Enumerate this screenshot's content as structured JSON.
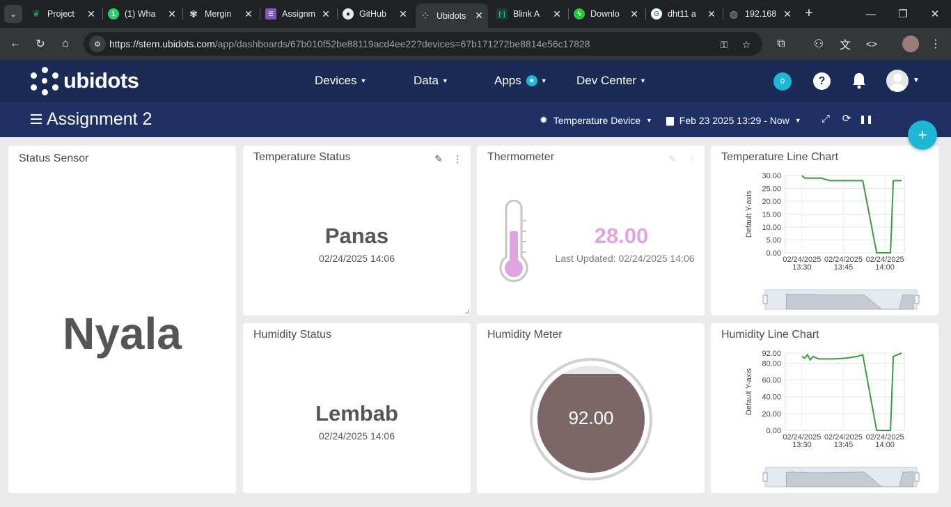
{
  "browser": {
    "tabs": [
      {
        "title": "Project",
        "icon": "mongodb-leaf-icon",
        "color": "#13aa52"
      },
      {
        "title": "(1) Wha",
        "icon": "whatsapp-icon",
        "color": "#25d366"
      },
      {
        "title": "Mergin",
        "icon": "chatgpt-icon",
        "color": "#e8eaed"
      },
      {
        "title": "Assignm",
        "icon": "forms-icon",
        "color": "#7e57c2"
      },
      {
        "title": "GitHub",
        "icon": "github-icon",
        "color": "#e8eaed"
      },
      {
        "title": "Ubidots",
        "icon": "ubidots-icon",
        "color": "#4db6e8"
      },
      {
        "title": "Blink A",
        "icon": "blynk-icon",
        "color": "#23c48e"
      },
      {
        "title": "Downlo",
        "icon": "bolt-icon",
        "color": "#24c73e"
      },
      {
        "title": "dht11 a",
        "icon": "google-icon",
        "color": "#4285f4"
      },
      {
        "title": "192.168",
        "icon": "globe-icon",
        "color": "#9aa0a6"
      }
    ],
    "url_host": "https://stem.ubidots.com",
    "url_path": "/app/dashboards/67b010f52be88119acd4ee22?devices=67b171272be8814e56c17828"
  },
  "header": {
    "logo": "ubidots",
    "nav": [
      "Devices",
      "Data",
      "Apps",
      "Dev Center"
    ],
    "notifications_count": "0",
    "help_label": "?"
  },
  "dashboard": {
    "title": "Assignment 2",
    "device": "Temperature Device",
    "date_range": "Feb 23 2025 13:29 - Now"
  },
  "widgets": {
    "status_sensor": {
      "title": "Status Sensor",
      "value": "Nyala"
    },
    "temperature_status": {
      "title": "Temperature Status",
      "value": "Panas",
      "timestamp": "02/24/2025 14:06"
    },
    "thermometer": {
      "title": "Thermometer",
      "value": "28.00",
      "updated": "Last Updated: 02/24/2025 14:06",
      "level": 0.28,
      "color": "#dfa5e0"
    },
    "humidity_status": {
      "title": "Humidity Status",
      "value": "Lembab",
      "timestamp": "02/24/2025 14:06"
    },
    "humidity_meter": {
      "title": "Humidity Meter",
      "value": "92.00",
      "level": 0.92,
      "color": "#7d6667"
    },
    "temperature_chart": {
      "title": "Temperature Line Chart"
    },
    "humidity_chart": {
      "title": "Humidity Line Chart"
    }
  },
  "chart_data": [
    {
      "type": "line",
      "title": "Temperature Line Chart",
      "ylabel": "Default Y-axis",
      "xlabel": "",
      "ylim": [
        0,
        30
      ],
      "yticks": [
        "30.00",
        "25.00",
        "20.00",
        "15.00",
        "10.00",
        "5.00",
        "0.00"
      ],
      "xticks": [
        "02/24/2025 13:30",
        "02/24/2025 13:45",
        "02/24/2025 14:00"
      ],
      "grid": true,
      "color": "#3a9b3a",
      "series": [
        {
          "x": [
            "13:30",
            "13:31",
            "13:33",
            "13:37",
            "13:40",
            "13:50",
            "13:52",
            "13:57",
            "14:00",
            "14:02",
            "14:03",
            "14:06"
          ],
          "values": [
            30,
            29,
            29,
            29,
            28,
            28,
            28,
            0,
            0,
            0,
            28,
            28
          ]
        }
      ]
    },
    {
      "type": "line",
      "title": "Humidity Line Chart",
      "ylabel": "Default Y-axis",
      "xlabel": "",
      "ylim": [
        0,
        92
      ],
      "yticks": [
        "92.00",
        "80.00",
        "60.00",
        "40.00",
        "20.00",
        "0.00"
      ],
      "xticks": [
        "02/24/2025 13:30",
        "02/24/2025 13:45",
        "02/24/2025 14:00"
      ],
      "grid": true,
      "color": "#3a9b3a",
      "series": [
        {
          "x": [
            "13:30",
            "13:31",
            "13:32",
            "13:33",
            "13:34",
            "13:36",
            "13:42",
            "13:46",
            "13:50",
            "13:52",
            "13:57",
            "14:00",
            "14:02",
            "14:03",
            "14:06"
          ],
          "values": [
            88,
            86,
            90,
            84,
            88,
            85,
            85,
            86,
            88,
            90,
            0,
            0,
            0,
            88,
            92
          ]
        }
      ]
    }
  ]
}
